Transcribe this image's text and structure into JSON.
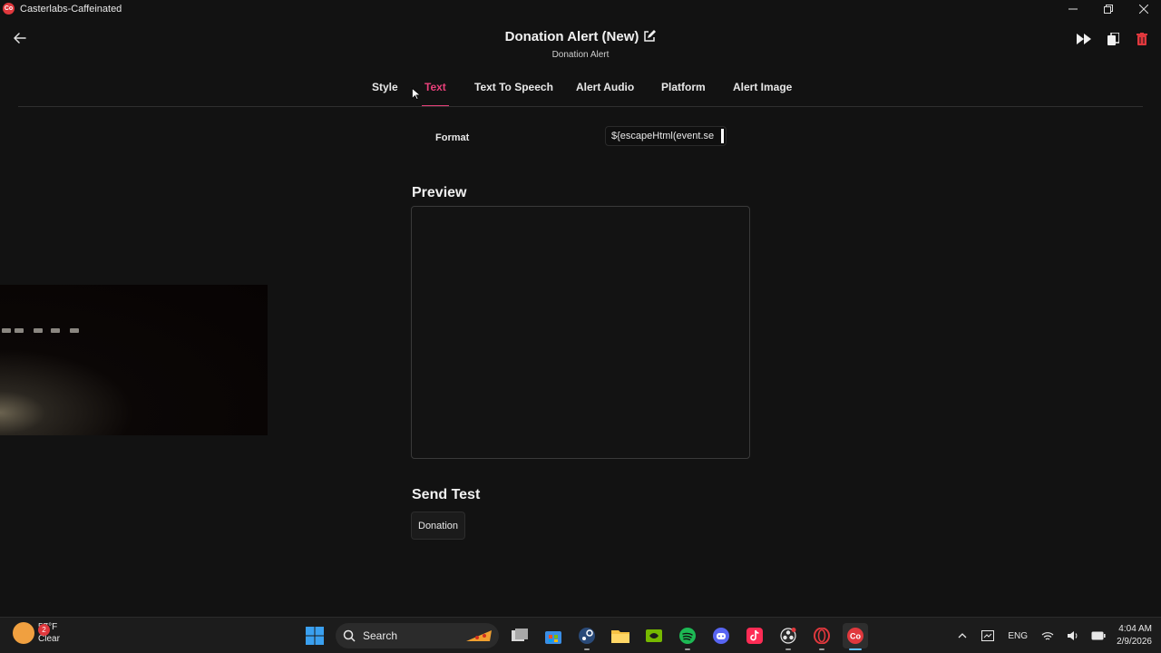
{
  "window": {
    "title": "Casterlabs-Caffeinated",
    "logo_text": "Co"
  },
  "header": {
    "title": "Donation Alert (New)",
    "subtitle": "Donation Alert"
  },
  "tabs": [
    {
      "label": "Style",
      "active": false
    },
    {
      "label": "Text",
      "active": true
    },
    {
      "label": "Text To Speech",
      "active": false
    },
    {
      "label": "Alert Audio",
      "active": false
    },
    {
      "label": "Platform",
      "active": false
    },
    {
      "label": "Alert Image",
      "active": false
    }
  ],
  "format": {
    "label": "Format",
    "value": "${escapeHtml(event.se"
  },
  "preview": {
    "title": "Preview"
  },
  "send_test": {
    "title": "Send Test",
    "button_label": "Donation"
  },
  "taskbar": {
    "weather_badge": "2",
    "temperature": "57°F",
    "condition": "Clear",
    "search_label": "Search",
    "language": "ENG",
    "time": "4:04 AM",
    "date": "2/9/2026"
  },
  "colors": {
    "accent": "#e8407a",
    "brand": "#e0383d",
    "background": "#121212"
  }
}
